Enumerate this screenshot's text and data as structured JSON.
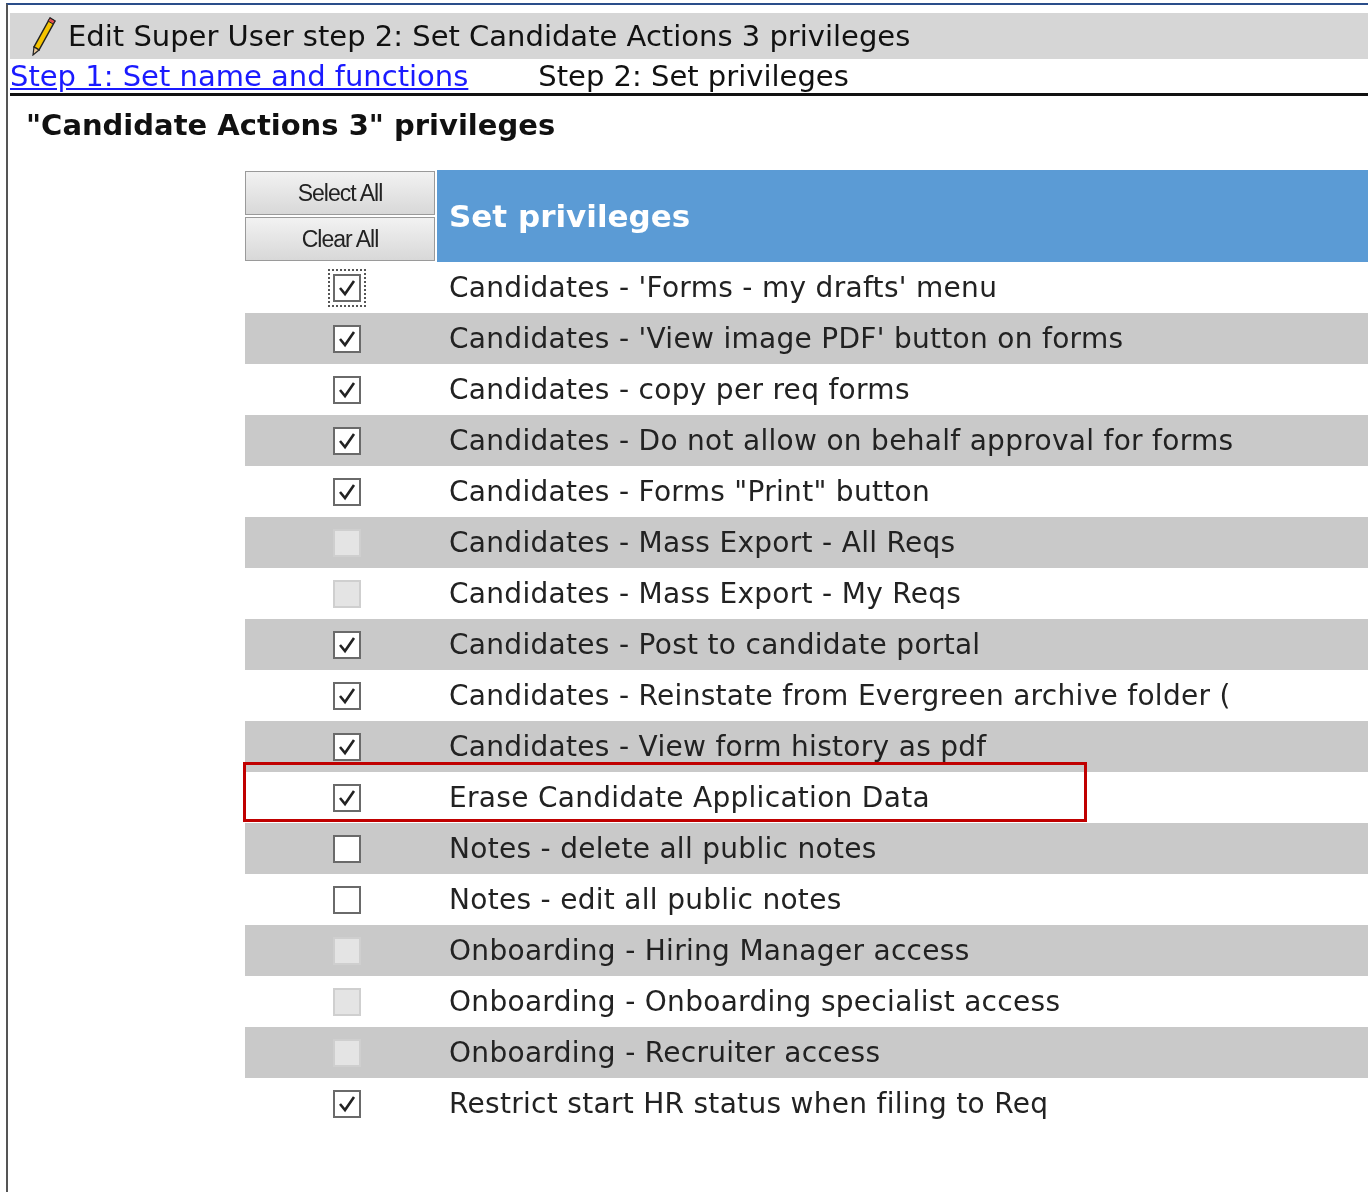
{
  "window": {
    "title": "Edit Super User step 2: Set Candidate Actions 3 privileges"
  },
  "steps": [
    {
      "label": "Step 1: Set name and functions",
      "kind": "link"
    },
    {
      "label": "Step 2: Set privileges",
      "kind": "current"
    }
  ],
  "heading": "\"Candidate Actions 3\" privileges",
  "table": {
    "buttons": [
      "Select All",
      "Clear All"
    ],
    "header": "Set privileges",
    "rows": [
      {
        "label": "Candidates - 'Forms - my drafts' menu",
        "checked": true,
        "disabled": false,
        "focused": true,
        "highlighted": false
      },
      {
        "label": "Candidates - 'View image PDF' button on forms",
        "checked": true,
        "disabled": false,
        "focused": false,
        "highlighted": false
      },
      {
        "label": "Candidates - copy per req forms",
        "checked": true,
        "disabled": false,
        "focused": false,
        "highlighted": false
      },
      {
        "label": "Candidates - Do not allow on behalf approval for forms",
        "checked": true,
        "disabled": false,
        "focused": false,
        "highlighted": false
      },
      {
        "label": "Candidates - Forms \"Print\" button",
        "checked": true,
        "disabled": false,
        "focused": false,
        "highlighted": false
      },
      {
        "label": "Candidates - Mass Export - All Reqs",
        "checked": false,
        "disabled": true,
        "focused": false,
        "highlighted": false
      },
      {
        "label": "Candidates - Mass Export - My Reqs",
        "checked": false,
        "disabled": true,
        "focused": false,
        "highlighted": false
      },
      {
        "label": "Candidates - Post to candidate portal",
        "checked": true,
        "disabled": false,
        "focused": false,
        "highlighted": false
      },
      {
        "label": "Candidates - Reinstate from Evergreen archive folder (",
        "checked": true,
        "disabled": false,
        "focused": false,
        "highlighted": false
      },
      {
        "label": "Candidates - View form history as pdf",
        "checked": true,
        "disabled": false,
        "focused": false,
        "highlighted": false
      },
      {
        "label": "Erase Candidate Application Data",
        "checked": true,
        "disabled": false,
        "focused": false,
        "highlighted": true
      },
      {
        "label": "Notes - delete all public notes",
        "checked": false,
        "disabled": false,
        "focused": false,
        "highlighted": false
      },
      {
        "label": "Notes - edit all public notes",
        "checked": false,
        "disabled": false,
        "focused": false,
        "highlighted": false
      },
      {
        "label": "Onboarding - Hiring Manager access",
        "checked": false,
        "disabled": true,
        "focused": false,
        "highlighted": false
      },
      {
        "label": "Onboarding - Onboarding specialist access",
        "checked": false,
        "disabled": true,
        "focused": false,
        "highlighted": false
      },
      {
        "label": "Onboarding - Recruiter access",
        "checked": false,
        "disabled": true,
        "focused": false,
        "highlighted": false
      },
      {
        "label": "Restrict start HR status when filing to Req",
        "checked": true,
        "disabled": false,
        "focused": false,
        "highlighted": false
      }
    ]
  }
}
